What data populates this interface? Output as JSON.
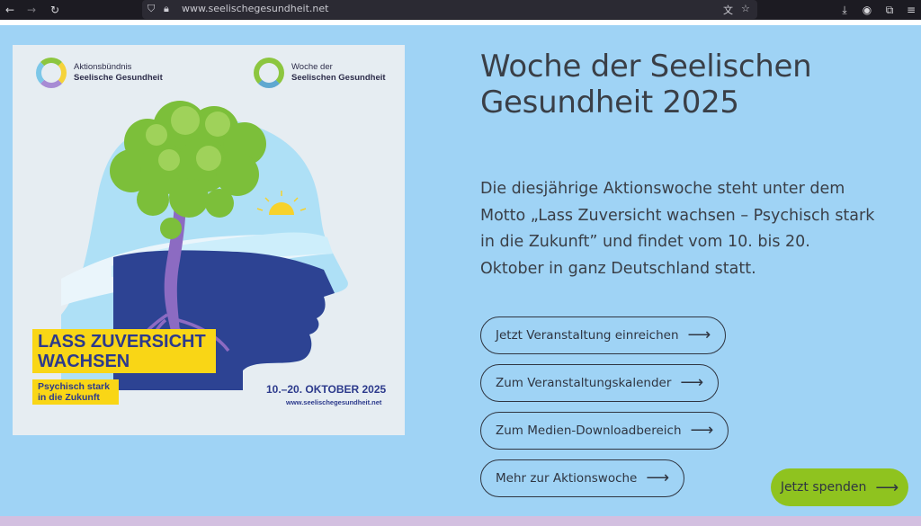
{
  "browser": {
    "url": "www.seelischegesundheit.net"
  },
  "poster": {
    "logo1_line1": "Aktionsbündnis",
    "logo1_line2": "Seelische Gesundheit",
    "logo2_line1": "Woche der",
    "logo2_line2": "Seelischen Gesundheit",
    "slogan_line1": "LASS ZUVERSICHT",
    "slogan_line2": "WACHSEN",
    "sub_line1": "Psychisch stark",
    "sub_line2": "in die Zukunft",
    "date": "10.–20. OKTOBER 2025",
    "url": "www.seelischegesundheit.net"
  },
  "main": {
    "title": "Woche der Seelischen Gesundheit 2025",
    "description": "Die diesjährige Aktionswoche steht unter dem Motto „Lass Zuversicht wachsen – Psychisch stark in die Zukunft” und findet vom 10. bis 20. Oktober in ganz Deutschland statt.",
    "buttons": [
      {
        "label": "Jetzt Veranstaltung einreichen"
      },
      {
        "label": "Zum Veranstaltungskalender"
      },
      {
        "label": "Zum Medien-Downloadbereich"
      },
      {
        "label": "Mehr zur Aktionswoche"
      }
    ],
    "arrow": "⟶",
    "donate_label": "Jetzt spenden"
  },
  "colors": {
    "page_bg": "#9fd3f5",
    "accent_green": "#8fc31f",
    "poster_navy": "#2c3a8c",
    "poster_yellow": "#f9d616",
    "bottom_strip": "#d3bfe0"
  }
}
